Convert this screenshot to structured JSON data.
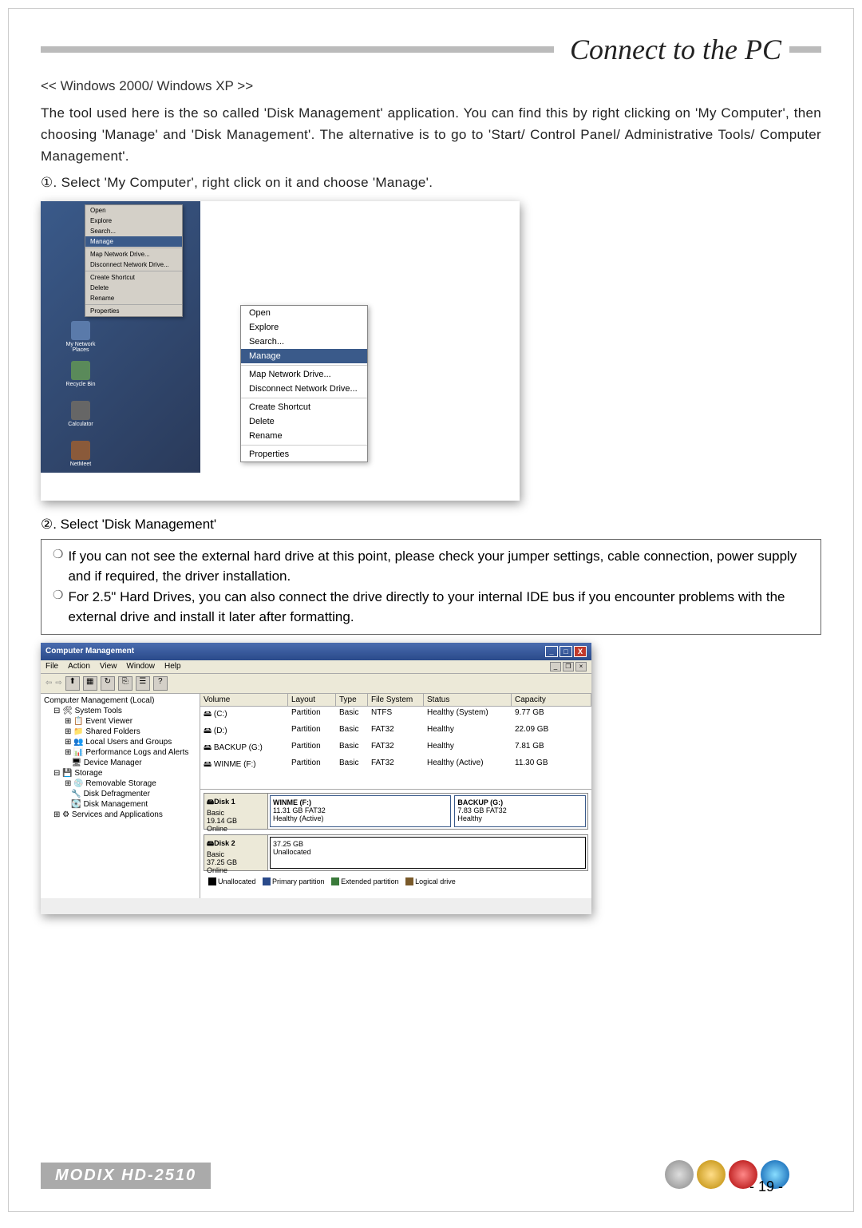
{
  "header": {
    "title": "Connect to the PC"
  },
  "subhead": "<< Windows 2000/  Windows XP >>",
  "intro": "The tool used here is the so called 'Disk Management' application. You can find this by right clicking on 'My Computer', then choosing 'Manage' and 'Disk Management'. The alternative is to go to 'Start/ Control Panel/ Administrative Tools/ Computer Management'.",
  "step1": "①. Select 'My Computer', right click on it and choose 'Manage'.",
  "contextMenu1": {
    "items": [
      "Open",
      "Explore",
      "Search...",
      "Manage",
      "Map Network Drive...",
      "Disconnect Network Drive...",
      "Create Shortcut",
      "Delete",
      "Rename",
      "Properties"
    ],
    "highlight": "Manage"
  },
  "desktopIcons": [
    "My Network Places",
    "Recycle Bin",
    "Calculator",
    "NetMeet"
  ],
  "contextMenu2": {
    "items": [
      "Open",
      "Explore",
      "Search...",
      "Manage",
      "Map Network Drive...",
      "Disconnect Network Drive...",
      "Create Shortcut",
      "Delete",
      "Rename",
      "Properties"
    ],
    "highlight": "Manage"
  },
  "step2": "②. Select 'Disk Management'",
  "notes": {
    "n1": "If you can not see the external hard drive at this point, please check your jumper settings, cable connection, power supply and if required, the driver installation.",
    "n2": "For 2.5\" Hard Drives, you can also connect the drive directly to your internal IDE bus if you encounter problems with the external drive and install it later after formatting."
  },
  "cm": {
    "title": "Computer Management",
    "menubar": [
      "File",
      "Action",
      "View",
      "Window",
      "Help"
    ],
    "tree": {
      "root": "Computer Management (Local)",
      "sysTools": "System Tools",
      "eventViewer": "Event Viewer",
      "sharedFolders": "Shared Folders",
      "localUsers": "Local Users and Groups",
      "perfLogs": "Performance Logs and Alerts",
      "devMgr": "Device Manager",
      "storage": "Storage",
      "removable": "Removable Storage",
      "defrag": "Disk Defragmenter",
      "diskMgmt": "Disk Management",
      "services": "Services and Applications"
    },
    "volHeaders": [
      "Volume",
      "Layout",
      "Type",
      "File System",
      "Status",
      "Capacity"
    ],
    "volumes": [
      {
        "name": "(C:)",
        "layout": "Partition",
        "type": "Basic",
        "fs": "NTFS",
        "status": "Healthy (System)",
        "capacity": "9.77 GB"
      },
      {
        "name": "(D:)",
        "layout": "Partition",
        "type": "Basic",
        "fs": "FAT32",
        "status": "Healthy",
        "capacity": "22.09 GB"
      },
      {
        "name": "BACKUP (G:)",
        "layout": "Partition",
        "type": "Basic",
        "fs": "FAT32",
        "status": "Healthy",
        "capacity": "7.81 GB"
      },
      {
        "name": "WINME (F:)",
        "layout": "Partition",
        "type": "Basic",
        "fs": "FAT32",
        "status": "Healthy (Active)",
        "capacity": "11.30 GB"
      }
    ],
    "disk1": {
      "label": "Disk 1",
      "type": "Basic",
      "size": "19.14 GB",
      "state": "Online",
      "p1": {
        "name": "WINME (F:)",
        "info": "11.31 GB FAT32",
        "status": "Healthy (Active)"
      },
      "p2": {
        "name": "BACKUP (G:)",
        "info": "7.83 GB FAT32",
        "status": "Healthy"
      }
    },
    "disk2": {
      "label": "Disk 2",
      "type": "Basic",
      "size": "37.25 GB",
      "state": "Online",
      "p1": {
        "name": "",
        "info": "37.25 GB",
        "status": "Unallocated"
      }
    },
    "legend": {
      "unalloc": "Unallocated",
      "primary": "Primary partition",
      "extended": "Extended partition",
      "logical": "Logical drive"
    }
  },
  "footer": {
    "brand": "MODIX HD-2510",
    "page": "-  19  -"
  }
}
